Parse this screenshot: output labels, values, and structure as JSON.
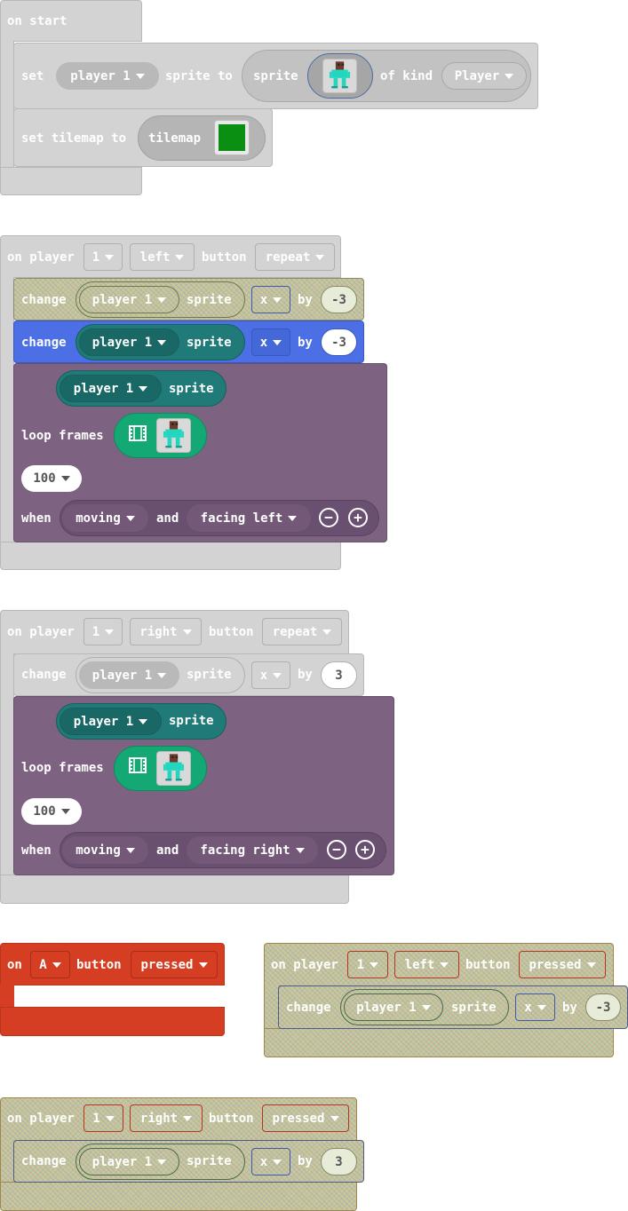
{
  "colors": {
    "disabled_block": "#d3d3d3",
    "purple_block": "#7e6281",
    "teal_sprite": "#1f7a78",
    "green_anim": "#14a874",
    "blue_block": "#4c6fe6",
    "red_block": "#d53e22",
    "hatch_block": "#c8c89a"
  },
  "on_start": {
    "hat": "on start",
    "set_label": "set",
    "var_dropdown": "player 1",
    "sprite_to": "sprite to",
    "sprite_label": "sprite",
    "sprite_icon": "player-sprite-image",
    "of_kind": "of kind",
    "kind_dropdown": "Player",
    "set_tilemap": "set tilemap to",
    "tilemap_label": "tilemap",
    "tilemap_icon": "green-tilemap-thumbnail"
  },
  "left_repeat": {
    "on_player": "on player",
    "player_num": "1",
    "direction": "left",
    "button": "button",
    "event": "repeat",
    "change1": {
      "change": "change",
      "var": "player 1",
      "sprite": "sprite",
      "axis": "x",
      "by": "by",
      "value": "-3"
    },
    "change2": {
      "change": "change",
      "var": "player 1",
      "sprite": "sprite",
      "axis": "x",
      "by": "by",
      "value": "-3"
    },
    "anim": {
      "var": "player 1",
      "sprite": "sprite",
      "loop_frames": "loop frames",
      "interval": "100",
      "when": "when",
      "state1": "moving",
      "and": "and",
      "state2": "facing left",
      "minus": "−",
      "plus": "+"
    }
  },
  "right_repeat": {
    "on_player": "on player",
    "player_num": "1",
    "direction": "right",
    "button": "button",
    "event": "repeat",
    "change1": {
      "change": "change",
      "var": "player 1",
      "sprite": "sprite",
      "axis": "x",
      "by": "by",
      "value": "3"
    },
    "anim": {
      "var": "player 1",
      "sprite": "sprite",
      "loop_frames": "loop frames",
      "interval": "100",
      "when": "when",
      "state1": "moving",
      "and": "and",
      "state2": "facing right",
      "minus": "−",
      "plus": "+"
    }
  },
  "a_button": {
    "on": "on",
    "key": "A",
    "button": "button",
    "event": "pressed"
  },
  "left_pressed": {
    "on_player": "on player",
    "player_num": "1",
    "direction": "left",
    "button": "button",
    "event": "pressed",
    "change": {
      "change": "change",
      "var": "player 1",
      "sprite": "sprite",
      "axis": "x",
      "by": "by",
      "value": "-3"
    }
  },
  "right_pressed": {
    "on_player": "on player",
    "player_num": "1",
    "direction": "right",
    "button": "button",
    "event": "pressed",
    "change": {
      "change": "change",
      "var": "player 1",
      "sprite": "sprite",
      "axis": "x",
      "by": "by",
      "value": "3"
    }
  }
}
